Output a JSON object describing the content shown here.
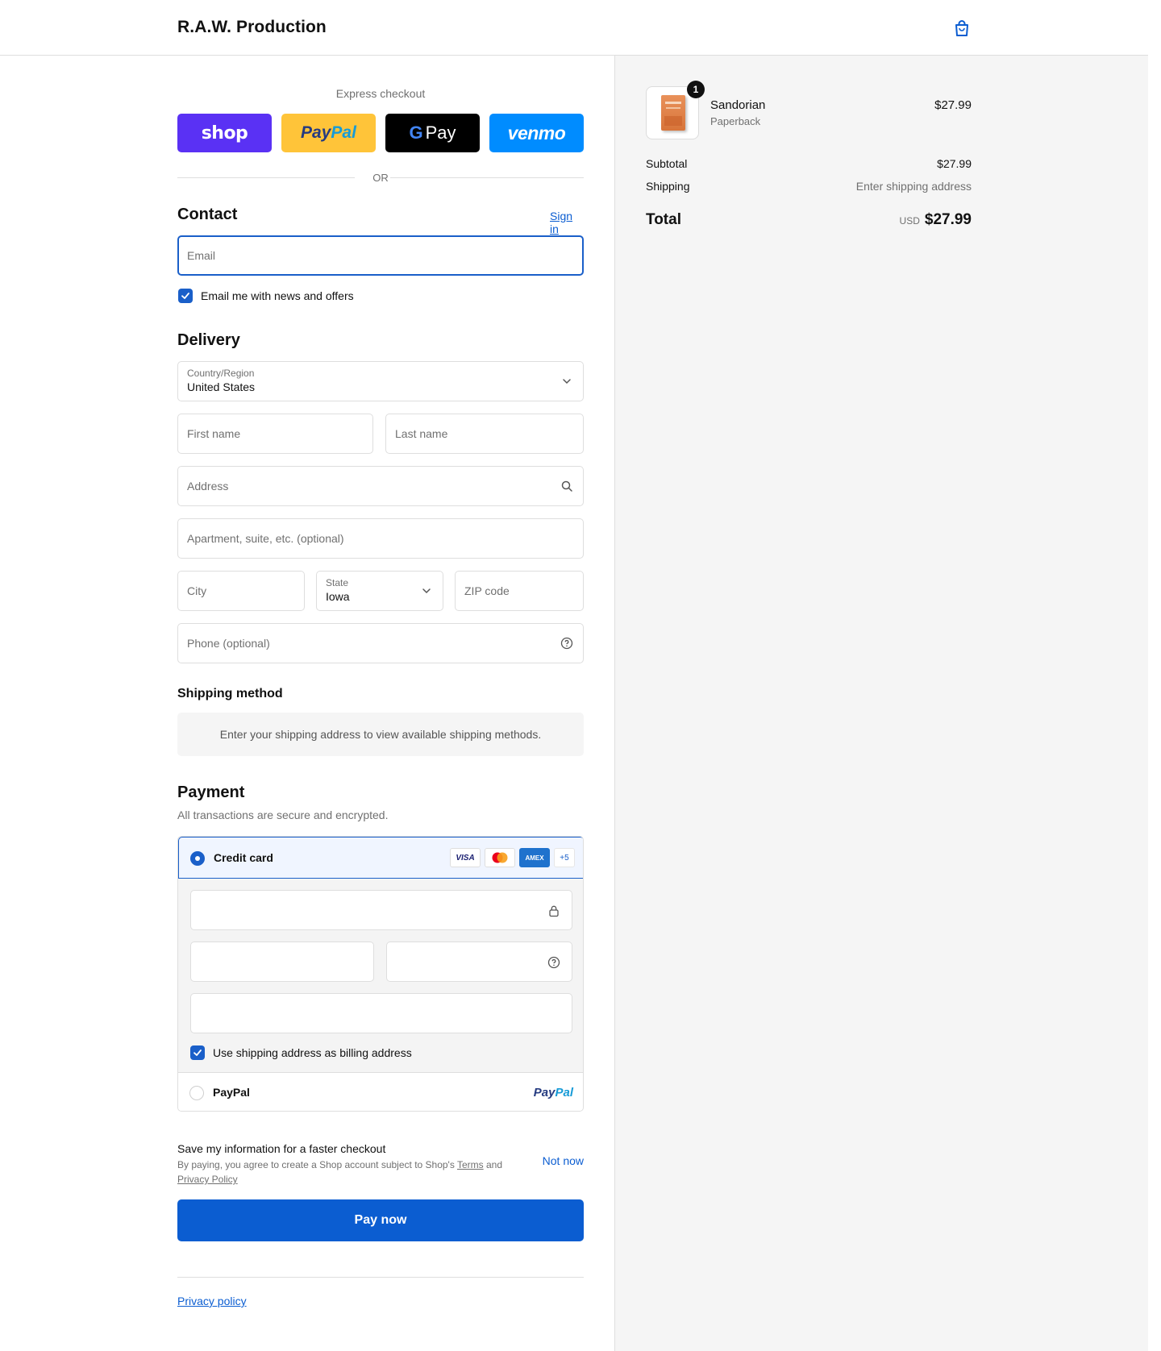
{
  "header": {
    "brand": "R.A.W. Production"
  },
  "express": {
    "label": "Express checkout",
    "buttons": {
      "shop": "shop",
      "paypal_a": "Pay",
      "paypal_b": "Pal",
      "gpay_g": "G",
      "gpay": "Pay",
      "venmo": "venmo"
    },
    "or": "OR"
  },
  "contact": {
    "title": "Contact",
    "sign_in": "Sign in",
    "email_placeholder": "Email",
    "newsletter_label": "Email me with news and offers"
  },
  "delivery": {
    "title": "Delivery",
    "country_label": "Country/Region",
    "country_value": "United States",
    "first_name": "First name",
    "last_name": "Last name",
    "address": "Address",
    "apartment": "Apartment, suite, etc. (optional)",
    "city": "City",
    "state_label": "State",
    "state_value": "Iowa",
    "zip": "ZIP code",
    "phone": "Phone (optional)"
  },
  "shipping": {
    "title": "Shipping method",
    "message": "Enter your shipping address to view available shipping methods."
  },
  "payment": {
    "title": "Payment",
    "subtitle": "All transactions are secure and encrypted.",
    "credit_card": "Credit card",
    "card_brands": {
      "visa": "VISA",
      "amex": "AMEX",
      "more": "+5"
    },
    "billing_label": "Use shipping address as billing address",
    "paypal": "PayPal",
    "paypal_logo_a": "Pay",
    "paypal_logo_b": "Pal"
  },
  "save": {
    "title": "Save my information for a faster checkout",
    "text_a": "By paying, you agree to create a Shop account subject to Shop's ",
    "terms": "Terms",
    "text_b": " and ",
    "privacy": "Privacy Policy",
    "not_now": "Not now"
  },
  "pay_now": "Pay now",
  "footer": {
    "privacy_policy": "Privacy policy"
  },
  "summary": {
    "item": {
      "name": "Sandorian",
      "variant": "Paperback",
      "price": "$27.99",
      "quantity": "1"
    },
    "subtotal_label": "Subtotal",
    "subtotal": "$27.99",
    "shipping_label": "Shipping",
    "shipping_value": "Enter shipping address",
    "total_label": "Total",
    "currency": "USD",
    "total": "$27.99"
  },
  "colors": {
    "accent": "#0b5dd1",
    "shop": "#5a31f4",
    "paypal": "#ffc439",
    "venmo": "#008cff"
  }
}
